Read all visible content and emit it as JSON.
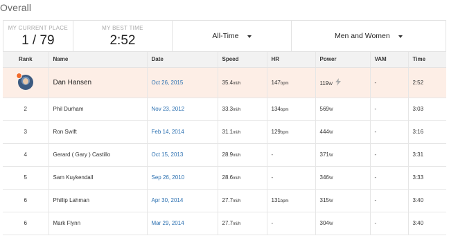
{
  "title": "Overall",
  "stats": {
    "current_place_label": "MY CURRENT PLACE",
    "current_place_value": "1 / 79",
    "best_time_label": "MY BEST TIME",
    "best_time_value": "2:52"
  },
  "filters": {
    "time_range": "All-Time",
    "gender": "Men and Women"
  },
  "columns": [
    "Rank",
    "Name",
    "Date",
    "Speed",
    "HR",
    "Power",
    "VAM",
    "Time"
  ],
  "rows": [
    {
      "rank": "",
      "name": "Dan Hansen",
      "date": "Oct 26, 2015",
      "speed": "35.4",
      "speed_unit": "mi/h",
      "hr": "147",
      "hr_unit": "bpm",
      "power": "119",
      "power_unit": "W",
      "vam": "-",
      "time": "2:52",
      "highlight": true
    },
    {
      "rank": "2",
      "name": "Phil Durham",
      "date": "Nov 23, 2012",
      "speed": "33.3",
      "speed_unit": "mi/h",
      "hr": "134",
      "hr_unit": "bpm",
      "power": "569",
      "power_unit": "W",
      "vam": "-",
      "time": "3:03"
    },
    {
      "rank": "3",
      "name": "Ron Swift",
      "date": "Feb 14, 2014",
      "speed": "31.1",
      "speed_unit": "mi/h",
      "hr": "129",
      "hr_unit": "bpm",
      "power": "444",
      "power_unit": "W",
      "vam": "-",
      "time": "3:16"
    },
    {
      "rank": "4",
      "name": "Gerard ( Gary ) Castillo",
      "date": "Oct 15, 2013",
      "speed": "28.9",
      "speed_unit": "mi/h",
      "hr": "-",
      "hr_unit": "",
      "power": "371",
      "power_unit": "W",
      "vam": "-",
      "time": "3:31"
    },
    {
      "rank": "5",
      "name": "Sam Kuykendall",
      "date": "Sep 26, 2010",
      "speed": "28.6",
      "speed_unit": "mi/h",
      "hr": "-",
      "hr_unit": "",
      "power": "346",
      "power_unit": "W",
      "vam": "-",
      "time": "3:33"
    },
    {
      "rank": "6",
      "name": "Phillip Lahman",
      "date": "Apr 30, 2014",
      "speed": "27.7",
      "speed_unit": "mi/h",
      "hr": "131",
      "hr_unit": "bpm",
      "power": "315",
      "power_unit": "W",
      "vam": "-",
      "time": "3:40"
    },
    {
      "rank": "6",
      "name": "Mark Flynn",
      "date": "Mar 29, 2014",
      "speed": "27.7",
      "speed_unit": "mi/h",
      "hr": "-",
      "hr_unit": "",
      "power": "304",
      "power_unit": "W",
      "vam": "-",
      "time": "3:40"
    }
  ],
  "colors": {
    "accent_link": "#2a6fb0",
    "highlight_row": "#fdeee6",
    "badge": "#f26a2a"
  }
}
